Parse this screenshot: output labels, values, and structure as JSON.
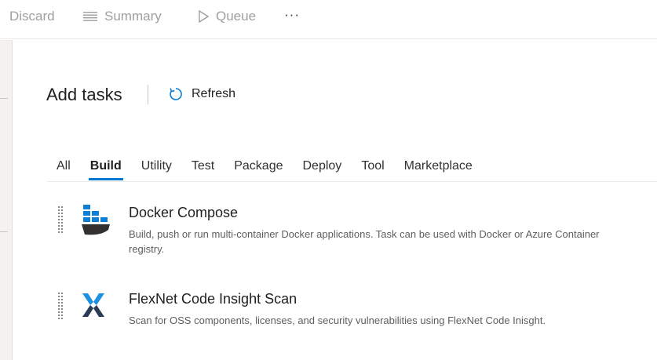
{
  "toolbar": {
    "discard_label": "Discard",
    "summary_label": "Summary",
    "queue_label": "Queue",
    "more_label": "···"
  },
  "panel": {
    "title": "Add tasks",
    "refresh_label": "Refresh"
  },
  "tabs": [
    {
      "label": "All",
      "active": false
    },
    {
      "label": "Build",
      "active": true
    },
    {
      "label": "Utility",
      "active": false
    },
    {
      "label": "Test",
      "active": false
    },
    {
      "label": "Package",
      "active": false
    },
    {
      "label": "Deploy",
      "active": false
    },
    {
      "label": "Tool",
      "active": false
    },
    {
      "label": "Marketplace",
      "active": false
    }
  ],
  "tasks": [
    {
      "title": "Docker Compose",
      "description": "Build, push or run multi-container Docker applications. Task can be used with Docker or Azure Container registry.",
      "icon": "docker-compose-icon"
    },
    {
      "title": "FlexNet Code Insight Scan",
      "description": "Scan for OSS components, licenses, and security vulnerabilities using FlexNet Code Inisght.",
      "icon": "flexnet-icon"
    }
  ],
  "colors": {
    "accent": "#0078d4",
    "disabled_text": "#a19f9d",
    "secondary_text": "#605e5c"
  }
}
